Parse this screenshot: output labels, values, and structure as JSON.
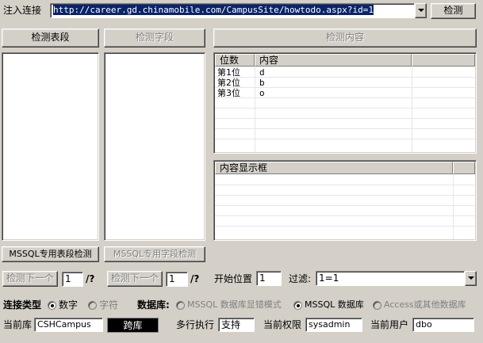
{
  "url_bar": {
    "label": "注入连接",
    "url": "http://career.gd.chinamobile.com/CampusSite/howtodo.aspx?id=1",
    "detect_button": "检测"
  },
  "left_panel": {
    "tables_button": "检测表段",
    "fields_button": "检测字段",
    "mssql_table_button": "MSSQL专用表段检测",
    "mssql_field_button": "MSSQL专用字段检测",
    "next_tables_button": "检测下一个",
    "next_tables_value": "1",
    "next_tables_suffix": "/?",
    "next_fields_button": "检测下一个",
    "next_fields_value": "1",
    "next_fields_suffix": "/?"
  },
  "content_panel": {
    "detect_content_button": "检测内容",
    "grid": {
      "columns": [
        "位数",
        "内容"
      ],
      "rows": [
        {
          "pos": "第1位",
          "content": "d"
        },
        {
          "pos": "第2位",
          "content": "b"
        },
        {
          "pos": "第3位",
          "content": "o"
        }
      ]
    },
    "display_box_header": "内容显示框"
  },
  "options": {
    "start_position_label": "开始位置",
    "start_position_value": "1",
    "filter_label": "过滤:",
    "filter_value": "1=1",
    "connection_type_label": "连接类型",
    "type_number": "数字",
    "type_char": "字符",
    "database_label": "数据库:",
    "db_mssql_error": "MSSQL 数据库显错模式",
    "db_mssql": "MSSQL 数据库",
    "db_access": "Access或其他数据库"
  },
  "status": {
    "current_db_label": "当前库",
    "current_db_value": "CSHCampus",
    "cross_db_button": "跨库",
    "multiline_label": "多行执行",
    "multiline_value": "支持",
    "current_priv_label": "当前权限",
    "current_priv_value": "sysadmin",
    "current_user_label": "当前用户",
    "current_user_value": "dbo"
  }
}
